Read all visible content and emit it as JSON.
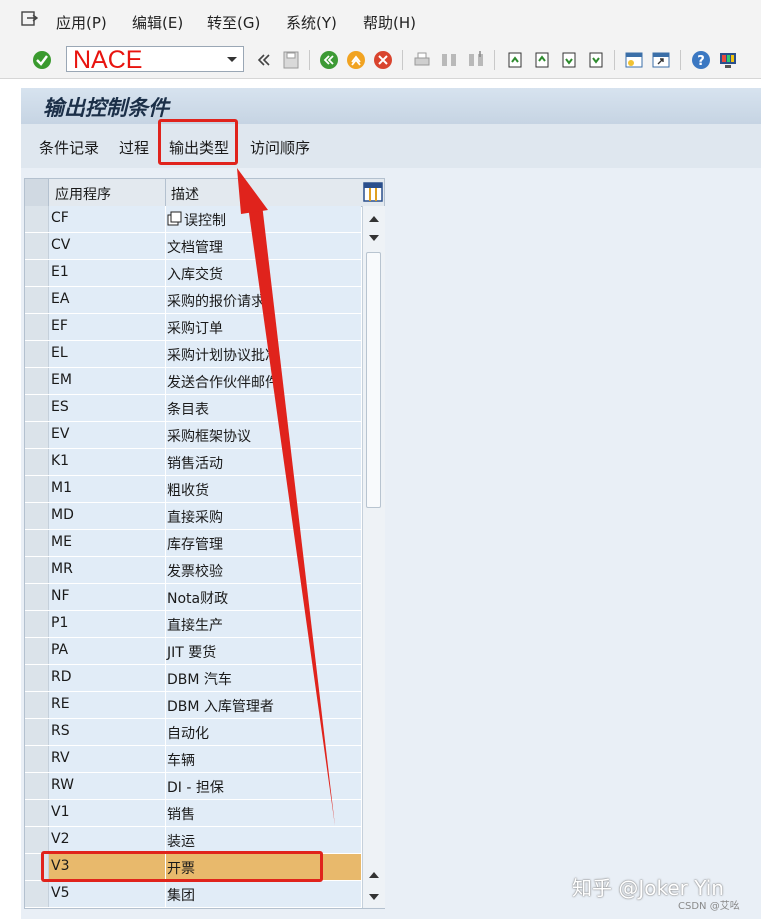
{
  "menu": {
    "items": [
      "应用(P)",
      "编辑(E)",
      "转至(G)",
      "系统(Y)",
      "帮助(H)"
    ]
  },
  "toolbar": {
    "command_value": "NACE",
    "icons": [
      "enter-icon",
      "history-back-icon",
      "save-icon",
      "back-icon",
      "exit-icon",
      "cancel-icon",
      "print-icon",
      "find-icon",
      "find-next-icon",
      "first-page-icon",
      "prev-page-icon",
      "next-page-icon",
      "last-page-icon",
      "new-session-icon",
      "shortcut-icon",
      "help-icon",
      "layout-icon"
    ]
  },
  "screen": {
    "title": "输出控制条件",
    "buttons": [
      "条件记录",
      "过程",
      "输出类型",
      "访问顺序"
    ]
  },
  "table": {
    "headers": [
      "应用程序",
      "描述"
    ],
    "rows": [
      {
        "app": "CF",
        "desc": "误控制"
      },
      {
        "app": "CV",
        "desc": "文档管理"
      },
      {
        "app": "E1",
        "desc": "入库交货"
      },
      {
        "app": "EA",
        "desc": "采购的报价请求"
      },
      {
        "app": "EF",
        "desc": "采购订单"
      },
      {
        "app": "EL",
        "desc": "采购计划协议批准"
      },
      {
        "app": "EM",
        "desc": "发送合作伙伴邮件"
      },
      {
        "app": "ES",
        "desc": "条目表"
      },
      {
        "app": "EV",
        "desc": "采购框架协议"
      },
      {
        "app": "K1",
        "desc": "销售活动"
      },
      {
        "app": "M1",
        "desc": "粗收货"
      },
      {
        "app": "MD",
        "desc": "直接采购"
      },
      {
        "app": "ME",
        "desc": "库存管理"
      },
      {
        "app": "MR",
        "desc": "发票校验"
      },
      {
        "app": "NF",
        "desc": "Nota财政"
      },
      {
        "app": "P1",
        "desc": "直接生产"
      },
      {
        "app": "PA",
        "desc": "JIT 要货"
      },
      {
        "app": "RD",
        "desc": "DBM 汽车"
      },
      {
        "app": "RE",
        "desc": "DBM 入库管理者"
      },
      {
        "app": "RS",
        "desc": "自动化"
      },
      {
        "app": "RV",
        "desc": "车辆"
      },
      {
        "app": "RW",
        "desc": "DI - 担保"
      },
      {
        "app": "V1",
        "desc": "销售"
      },
      {
        "app": "V2",
        "desc": "装运"
      },
      {
        "app": "V3",
        "desc": "开票",
        "selected": true
      },
      {
        "app": "V5",
        "desc": "集团"
      }
    ]
  },
  "watermark": {
    "main": "知乎 @Joker Yin",
    "sub": "CSDN @艾吆"
  },
  "colors": {
    "accent_red": "#e0231c",
    "selected_row": "#e8b96c",
    "cell_bg": "#e1ecf7",
    "command_text": "#e8140f"
  }
}
